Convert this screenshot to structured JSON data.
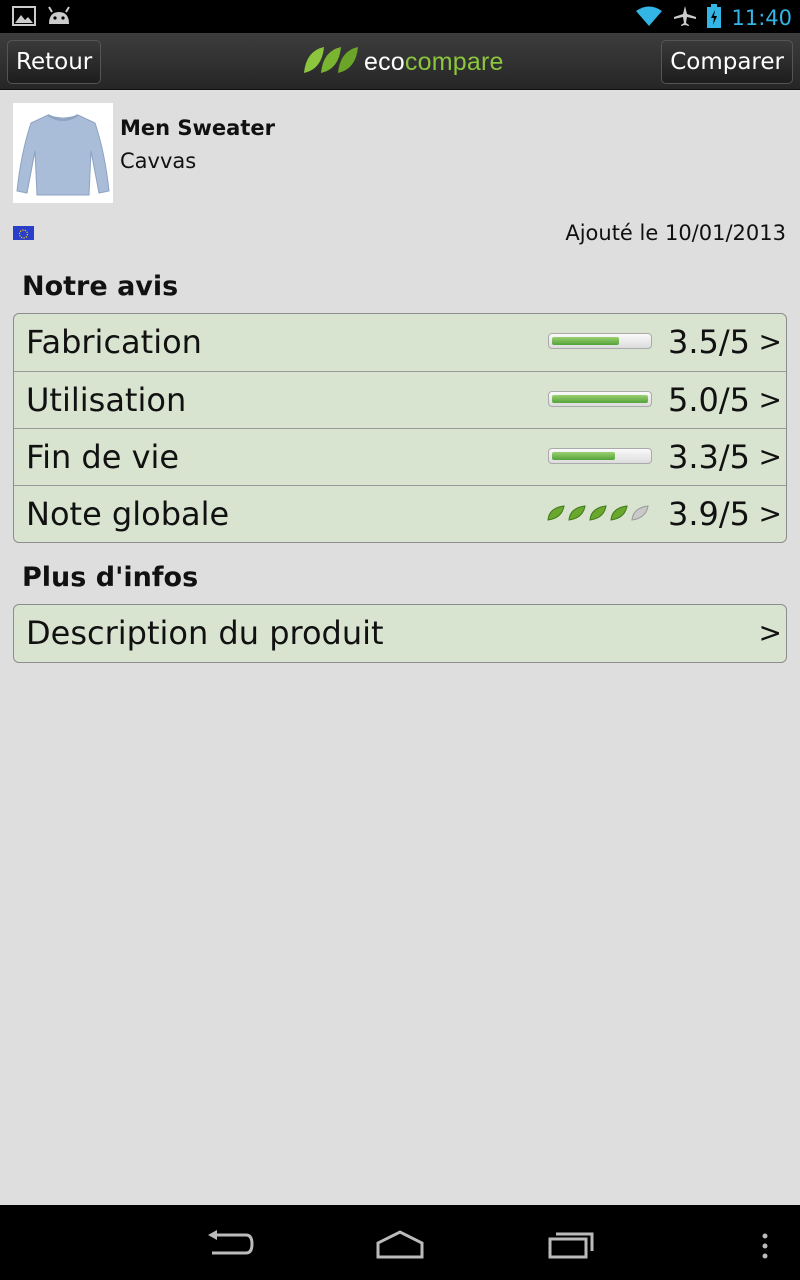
{
  "status_bar": {
    "left_icons": [
      "gallery-icon",
      "android-icon"
    ],
    "right_icons": [
      "wifi-icon",
      "airplane-mode-icon",
      "battery-charging-icon"
    ],
    "time": "11:40",
    "time_color": "#33b5e5"
  },
  "action_bar": {
    "back_label": "Retour",
    "compare_label": "Comparer",
    "logo": {
      "part1": "eco",
      "part2": "compare",
      "accent": "#8cc63f"
    }
  },
  "product": {
    "name": "Men Sweater",
    "brand": "Cavvas",
    "origin_flag": "eu-flag-icon",
    "added_date": "Ajouté le 10/01/2013"
  },
  "ratings_section": {
    "title": "Notre avis",
    "items": [
      {
        "label": "Fabrication",
        "score": "3.5/5",
        "value": 3.5,
        "arrow": ">"
      },
      {
        "label": "Utilisation",
        "score": "5.0/5",
        "value": 5.0,
        "arrow": ">"
      },
      {
        "label": "Fin de vie",
        "score": "3.3/5",
        "value": 3.3,
        "arrow": ">"
      },
      {
        "label": "Note globale",
        "score": "3.9/5",
        "value": 3.9,
        "leaves_filled": 4,
        "leaves_total": 5,
        "arrow": ">"
      }
    ]
  },
  "info_section": {
    "title": "Plus d'infos",
    "items": [
      {
        "label": "Description du produit",
        "arrow": ">"
      }
    ]
  },
  "nav_bar": {
    "icons": [
      "back-icon",
      "home-icon",
      "recent-apps-icon",
      "menu-overflow-icon"
    ]
  }
}
